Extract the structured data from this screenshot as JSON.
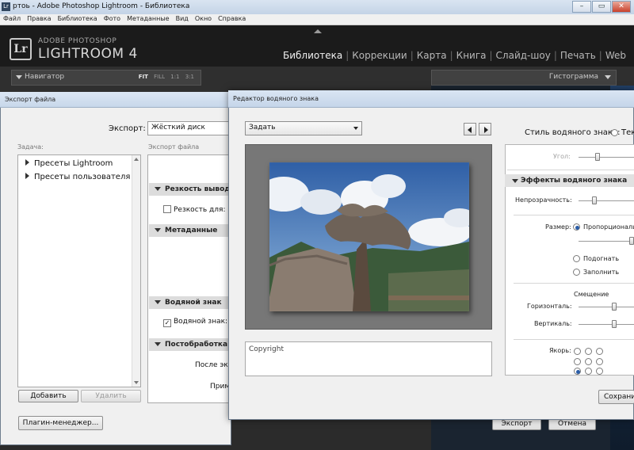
{
  "window": {
    "title": "ртоь - Adobe Photoshop Lightroom - Библиотека",
    "app_icon": "lr-app-icon"
  },
  "menu": [
    "Файл",
    "Правка",
    "Библиотека",
    "Фото",
    "Метаданные",
    "Вид",
    "Окно",
    "Справка"
  ],
  "lightroom": {
    "brand_sub": "ADOBE PHOTOSHOP",
    "brand_name": "LIGHTROOM 4",
    "logo": "Lr",
    "modules": [
      "Библиотека",
      "Коррекции",
      "Карта",
      "Книга",
      "Слайд-шоу",
      "Печать",
      "Web"
    ],
    "active_module": "Библиотека",
    "navigator": {
      "title": "Навигатор",
      "zoom": [
        "FIT",
        "FILL",
        "1:1",
        "3:1"
      ]
    },
    "histogram": {
      "title": "Гистограмма"
    }
  },
  "export_dialog": {
    "title": "Экспорт файла",
    "export_label": "Экспорт:",
    "export_target": "Жёсткий диск",
    "task_label": "Задача:",
    "file_label": "Экспорт файла",
    "presets": [
      "Пресеты Lightroom",
      "Пресеты пользователя"
    ],
    "sections": {
      "sharpen": "Резкость вывода",
      "sharpen_for": "Резкость для:",
      "metadata": "Метаданные",
      "watermark": "Водяной знак",
      "watermark_cb": "Водяной знак:",
      "post": "Постобработка",
      "after": "После экспо",
      "apply": "Прим"
    },
    "add_button": "Добавить",
    "remove_button": "Удалить",
    "plugin_button": "Плагин-менеджер...",
    "export_button": "Экспорт",
    "cancel_button": "Отмена"
  },
  "watermark_editor": {
    "title": "Редактор водяного знака",
    "preset": "Задать",
    "style_label": "Стиль водяного знака:",
    "style_option": "Текс",
    "copyright_text": "Copyright",
    "angle_label": "Угол:",
    "effects_header": "Эффекты водяного знака",
    "opacity_label": "Непрозрачность:",
    "size_label": "Размер:",
    "size_options": [
      "Пропорциональн",
      "Подогнать",
      "Заполнить"
    ],
    "offset_title": "Смещение",
    "horizontal_label": "Горизонталь:",
    "vertical_label": "Вертикаль:",
    "anchor_label": "Якорь:",
    "save_button": "Сохрани"
  }
}
